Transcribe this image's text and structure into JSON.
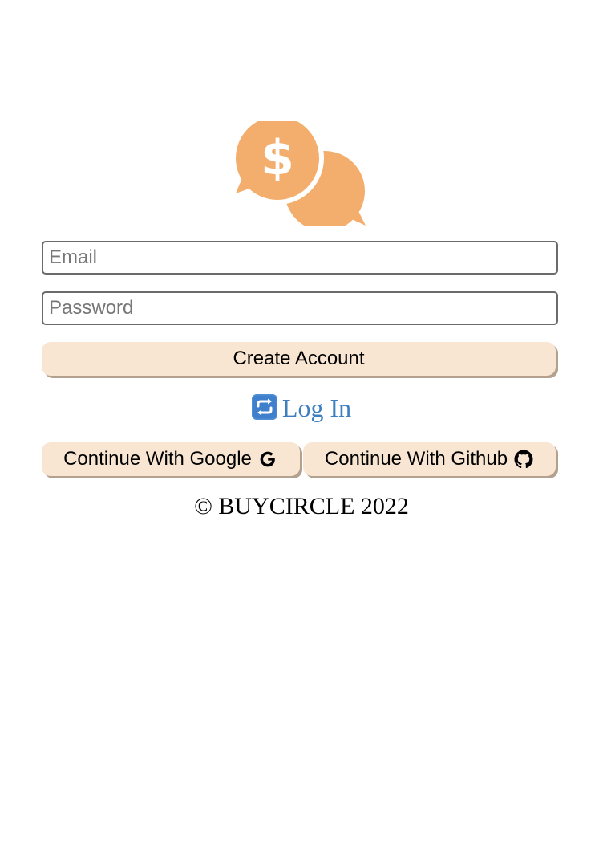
{
  "colors": {
    "brand": "#f3ae6e",
    "button_bg": "#f8e6d3",
    "button_shadow": "#b3a08f",
    "link": "#3d7ebf"
  },
  "logo": {
    "icon": "chat-bubbles-dollar-icon"
  },
  "form": {
    "email_placeholder": "Email",
    "password_placeholder": "Password",
    "create_account_label": "Create Account"
  },
  "login": {
    "icon": "repeat-arrows-icon",
    "label": "Log In"
  },
  "oauth": {
    "google_label": "Continue With Google",
    "google_icon": "google-icon",
    "github_label": "Continue With Github",
    "github_icon": "github-icon"
  },
  "footer": {
    "text": "© BUYCIRCLE 2022"
  }
}
